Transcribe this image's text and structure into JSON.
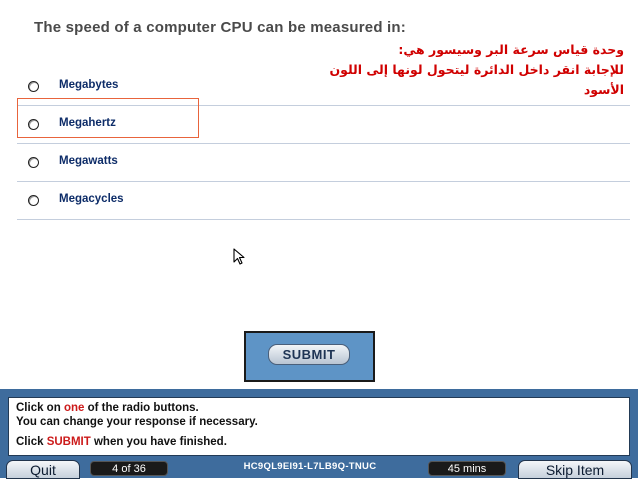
{
  "question": {
    "text": "The speed of a computer CPU can be measured in:"
  },
  "arabic_note": {
    "line1": "وحدة قياس سرعة البر وسيسور هي:",
    "line2": "للإجابة انقر داخل الدائرة ليتحول لونها إلى اللون الأسود"
  },
  "options": [
    {
      "label": "Megabytes"
    },
    {
      "label": "Megahertz"
    },
    {
      "label": "Megawatts"
    },
    {
      "label": "Megacycles"
    }
  ],
  "submit": {
    "label": "SUBMIT"
  },
  "instructions": {
    "line1_pre": "Click on ",
    "line1_em": "one",
    "line1_post": " of the radio buttons.",
    "line2": "You can change your response if necessary.",
    "line3_pre": "Click ",
    "line3_em": "SUBMIT",
    "line3_post": " when you have finished."
  },
  "footer": {
    "quit_label": "Quit",
    "counter": "4 of 36",
    "code": "HC9QL9EI91-L7LB9Q-TNUC",
    "timer": "45 mins",
    "skip_label": "Skip Item"
  },
  "colors": {
    "accent": "#3e6c9d",
    "arabic_text": "#d00000",
    "option_text": "#0d2c68",
    "highlight_border": "#e8643c"
  }
}
